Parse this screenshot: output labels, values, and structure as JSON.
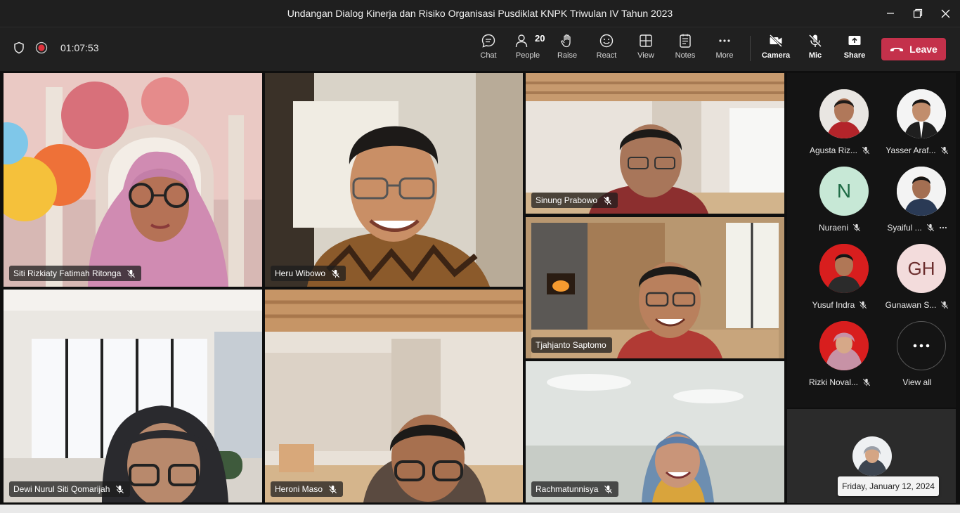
{
  "window": {
    "title": "Undangan Dialog Kinerja dan Risiko Organisasi Pusdiklat KNPK Triwulan IV Tahun 2023"
  },
  "toolbar": {
    "timer": "01:07:53",
    "people_count": "20",
    "buttons": {
      "chat": "Chat",
      "people": "People",
      "raise": "Raise",
      "react": "React",
      "view": "View",
      "notes": "Notes",
      "more": "More",
      "camera": "Camera",
      "mic": "Mic",
      "share": "Share"
    },
    "leave": "Leave"
  },
  "tiles": [
    {
      "name": "Siti Rizkiaty Fatimah Ritonga"
    },
    {
      "name": "Heru Wibowo"
    },
    {
      "name": "Sinung Prabowo"
    },
    {
      "name": "Tjahjanto Saptomo"
    },
    {
      "name": "Dewi Nurul Siti Qomarijah"
    },
    {
      "name": "Heroni Maso"
    },
    {
      "name": "Rachmatunnisya"
    }
  ],
  "panel": {
    "participants": [
      {
        "name": "Agusta Riz..."
      },
      {
        "name": "Yasser Araf..."
      },
      {
        "name": "Nuraeni",
        "initials": "N"
      },
      {
        "name": "Syaiful ..."
      },
      {
        "name": "Yusuf Indra"
      },
      {
        "name": "Gunawan S...",
        "initials": "GH"
      },
      {
        "name": "Rizki Noval..."
      }
    ],
    "view_all": "View all"
  },
  "selfview": {
    "date": "Friday, January 12, 2024"
  },
  "colors": {
    "accent": "#7f85f5",
    "leave": "#c4314b",
    "initials_n_bg": "#c7e8d6",
    "initials_gh_bg": "#f3dcdc"
  }
}
